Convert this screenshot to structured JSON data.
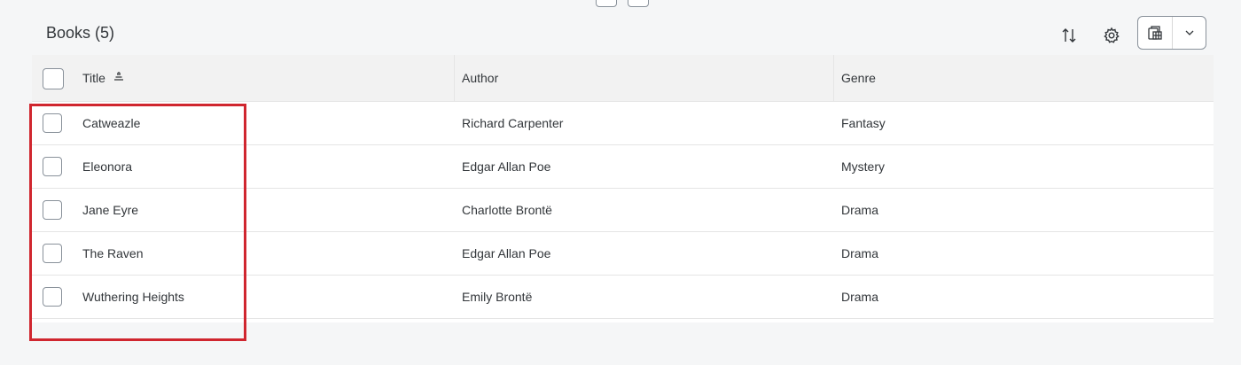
{
  "table": {
    "title": "Books (5)",
    "columns": {
      "title": "Title",
      "author": "Author",
      "genre": "Genre"
    },
    "rows": [
      {
        "title": "Catweazle",
        "author": "Richard Carpenter",
        "genre": "Fantasy"
      },
      {
        "title": "Eleonora",
        "author": "Edgar Allan Poe",
        "genre": "Mystery"
      },
      {
        "title": "Jane Eyre",
        "author": "Charlotte Brontë",
        "genre": "Drama"
      },
      {
        "title": "The Raven",
        "author": "Edgar Allan Poe",
        "genre": "Drama"
      },
      {
        "title": "Wuthering Heights",
        "author": "Emily Brontë",
        "genre": "Drama"
      }
    ]
  },
  "toolbar": {
    "icons": [
      "sort-icon",
      "settings-icon",
      "export-icon",
      "chevron-down-icon"
    ]
  },
  "colors": {
    "highlight": "#d0262f",
    "header_bg": "#f2f2f2",
    "border": "#89919a"
  }
}
